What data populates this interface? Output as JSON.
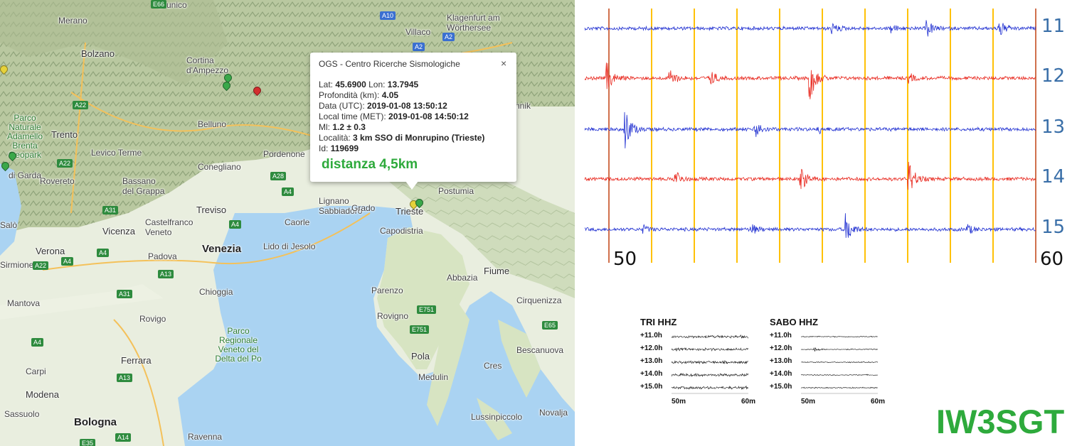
{
  "map": {
    "places": [
      {
        "name": "Brunico",
        "cls": ""
      },
      {
        "name": "Merano",
        "cls": ""
      },
      {
        "name": "Villaco",
        "cls": ""
      },
      {
        "name": "Klagenfurt am Wörthersee",
        "cls": ""
      },
      {
        "name": "Bolzano",
        "cls": "med"
      },
      {
        "name": "Cortina d'Ampezzo",
        "cls": ""
      },
      {
        "name": "Parco Naturale Adamello Brenta Geopark",
        "cls": "green"
      },
      {
        "name": "Belluno",
        "cls": ""
      },
      {
        "name": "Trento",
        "cls": "med"
      },
      {
        "name": "Levico Terme",
        "cls": ""
      },
      {
        "name": "Pordenone",
        "cls": ""
      },
      {
        "name": "Conegliano",
        "cls": ""
      },
      {
        "name": "Rovereto",
        "cls": ""
      },
      {
        "name": "Bassano del Grappa",
        "cls": ""
      },
      {
        "name": "Lignano Sabbiadoro",
        "cls": ""
      },
      {
        "name": "Grado",
        "cls": ""
      },
      {
        "name": "Postumia",
        "cls": ""
      },
      {
        "name": "Trieste",
        "cls": "med"
      },
      {
        "name": "Treviso",
        "cls": "med"
      },
      {
        "name": "Caorle",
        "cls": ""
      },
      {
        "name": "Capodistria",
        "cls": ""
      },
      {
        "name": "Castelfranco Veneto",
        "cls": ""
      },
      {
        "name": "Vicenza",
        "cls": "med"
      },
      {
        "name": "Venezia",
        "cls": "big"
      },
      {
        "name": "Lido di Jesolo",
        "cls": ""
      },
      {
        "name": "Verona",
        "cls": "med"
      },
      {
        "name": "Padova",
        "cls": ""
      },
      {
        "name": "Abbazia",
        "cls": ""
      },
      {
        "name": "Fiume",
        "cls": "med"
      },
      {
        "name": "Chioggia",
        "cls": ""
      },
      {
        "name": "Parenzo",
        "cls": ""
      },
      {
        "name": "Mantova",
        "cls": ""
      },
      {
        "name": "Rovigo",
        "cls": ""
      },
      {
        "name": "Cirquenizza",
        "cls": ""
      },
      {
        "name": "Rovigno",
        "cls": ""
      },
      {
        "name": "Parco Regionale Veneto del Delta del Po",
        "cls": "green"
      },
      {
        "name": "Ferrara",
        "cls": "med"
      },
      {
        "name": "Bescanuova",
        "cls": ""
      },
      {
        "name": "Pola",
        "cls": "med"
      },
      {
        "name": "Cres",
        "cls": ""
      },
      {
        "name": "Carpi",
        "cls": ""
      },
      {
        "name": "Medulin",
        "cls": ""
      },
      {
        "name": "Modena",
        "cls": "med"
      },
      {
        "name": "Sassuolo",
        "cls": ""
      },
      {
        "name": "Lussinpiccolo",
        "cls": ""
      },
      {
        "name": "Novalja",
        "cls": ""
      },
      {
        "name": "Bologna",
        "cls": "big"
      },
      {
        "name": "Ravenna",
        "cls": ""
      },
      {
        "name": "nnik",
        "cls": ""
      },
      {
        "name": "di Garda",
        "cls": ""
      },
      {
        "name": "Sirmione",
        "cls": ""
      },
      {
        "name": "Salò",
        "cls": ""
      }
    ],
    "roads": [
      "E66",
      "A10",
      "A2",
      "A2",
      "A22",
      "A22",
      "A28",
      "A4",
      "A31",
      "A4",
      "A4",
      "A4",
      "A13",
      "A22",
      "A4",
      "A31",
      "A13",
      "E751",
      "E751",
      "A14",
      "E35",
      "E65"
    ],
    "markers": [
      {
        "color": "#3aa84a"
      },
      {
        "color": "#3aa84a"
      },
      {
        "color": "#d32f2f"
      },
      {
        "color": "#3aa84a"
      },
      {
        "color": "#3aa84a"
      },
      {
        "color": "#e6d23a"
      },
      {
        "color": "#e6d23a"
      },
      {
        "color": "#3aa84a"
      }
    ]
  },
  "popup": {
    "title": "OGS - Centro Ricerche Sismologiche",
    "close": "×",
    "rows": [
      {
        "label": "Lat:",
        "value": "45.6900",
        "label2": "Lon:",
        "value2": "13.7945"
      },
      {
        "label": "Profondità (km):",
        "value": "4.05"
      },
      {
        "label": "Data (UTC):",
        "value": "2019-01-08 13:50:12"
      },
      {
        "label": "Local time (MET):",
        "value": "2019-01-08 14:50:12"
      },
      {
        "label": "Ml:",
        "value": "1.2 ± 0.3"
      },
      {
        "label": "Località:",
        "value": "3 km SSO di Monrupino (Trieste)"
      },
      {
        "label": "Id:",
        "value": "119699"
      }
    ],
    "distance": "distanza 4,5km"
  },
  "seismogram": {
    "hours": [
      "11",
      "12",
      "13",
      "14",
      "15"
    ],
    "min_start": "50",
    "min_end": "60",
    "colors": {
      "blue": "#1f2fd1",
      "red": "#e8261c",
      "orange": "#ffc107",
      "edge": "#c04010"
    },
    "rows": [
      {
        "hour": "11",
        "color": "blue",
        "events": [
          {
            "t": 0.55,
            "a": 7
          },
          {
            "t": 0.68,
            "a": 5
          },
          {
            "t": 0.76,
            "a": 11
          },
          {
            "t": 0.92,
            "a": 12
          }
        ]
      },
      {
        "hour": "12",
        "color": "red",
        "events": [
          {
            "t": 0.05,
            "a": 20
          },
          {
            "t": 0.19,
            "a": 13
          },
          {
            "t": 0.28,
            "a": 10
          },
          {
            "t": 0.5,
            "a": 30
          },
          {
            "t": 0.72,
            "a": 6
          }
        ]
      },
      {
        "hour": "13",
        "color": "blue",
        "events": [
          {
            "t": 0.09,
            "a": 30
          },
          {
            "t": 0.38,
            "a": 12
          },
          {
            "t": 0.52,
            "a": 5
          }
        ]
      },
      {
        "hour": "14",
        "color": "red",
        "events": [
          {
            "t": 0.2,
            "a": 14
          },
          {
            "t": 0.48,
            "a": 17
          },
          {
            "t": 0.72,
            "a": 24
          }
        ]
      },
      {
        "hour": "15",
        "color": "blue",
        "events": [
          {
            "t": 0.13,
            "a": 5
          },
          {
            "t": 0.37,
            "a": 7
          },
          {
            "t": 0.58,
            "a": 21
          },
          {
            "t": 0.85,
            "a": 6
          }
        ]
      }
    ]
  },
  "thumbs": [
    {
      "title": "TRI HHZ",
      "hours": [
        "+11.0h",
        "+12.0h",
        "+13.0h",
        "+14.0h",
        "+15.0h"
      ],
      "m_start": "50m",
      "m_end": "60m",
      "noise": 4
    },
    {
      "title": "SABO HHZ",
      "hours": [
        "+11.0h",
        "+12.0h",
        "+13.0h",
        "+14.0h",
        "+15.0h"
      ],
      "m_start": "50m",
      "m_end": "60m",
      "noise": 1.5
    }
  ],
  "brand": "IW3SGT"
}
